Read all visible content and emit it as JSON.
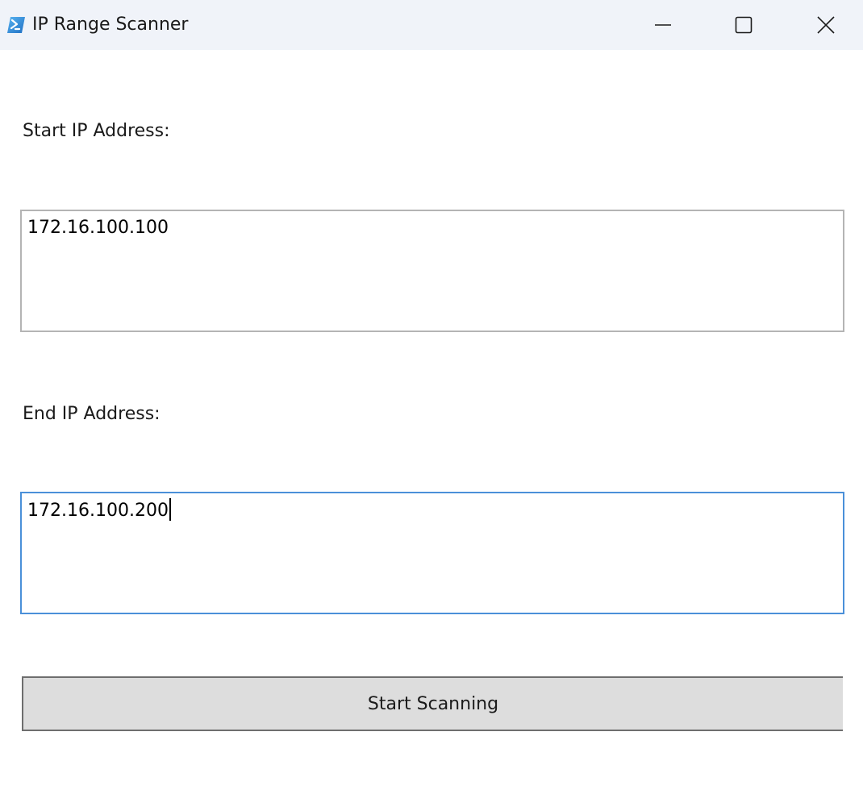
{
  "window": {
    "title": "IP Range Scanner",
    "icon": "powershell-icon",
    "controls": {
      "minimize": "minimize-icon",
      "maximize": "maximize-icon",
      "close": "close-icon"
    }
  },
  "form": {
    "start_label": "Start IP Address:",
    "start_value": "172.16.100.100",
    "end_label": "End IP Address:",
    "end_value": "172.16.100.200",
    "scan_button_label": "Start Scanning"
  },
  "colors": {
    "titlebar_bg": "#f0f3f9",
    "focus_border": "#4a90d9",
    "button_bg": "#dddddd"
  }
}
